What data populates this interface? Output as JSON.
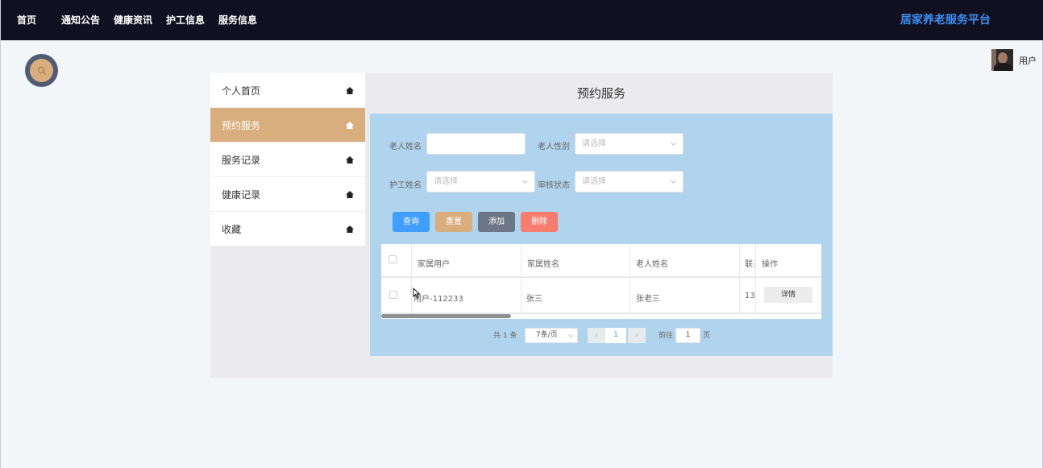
{
  "nav": {
    "items": [
      "首页",
      "通知公告",
      "健康资讯",
      "护工信息",
      "服务信息"
    ],
    "brand": "居家养老服务平台"
  },
  "user": {
    "name": "用户"
  },
  "sidebar": {
    "items": [
      {
        "label": "个人首页"
      },
      {
        "label": "预约服务"
      },
      {
        "label": "服务记录"
      },
      {
        "label": "健康记录"
      },
      {
        "label": "收藏"
      }
    ],
    "active": "预约服务"
  },
  "main": {
    "title": "预约服务"
  },
  "filters": {
    "elder_name_label": "老人姓名",
    "elder_name_value": "",
    "elder_gender_label": "老人性别",
    "elder_gender_placeholder": "请选择",
    "caregiver_label": "护工姓名",
    "caregiver_placeholder": "请选择",
    "review_label": "审核状态",
    "review_placeholder": "请选择"
  },
  "buttons": {
    "query": "查询",
    "reset": "重置",
    "add": "添加",
    "delete": "删除"
  },
  "colors": {
    "nav_bg": "#111020",
    "brand": "#3d8ef0",
    "accent": "#d9ae7e",
    "panel_bg": "#b0d4ee",
    "query_btn": "#409eff",
    "reset_btn": "#d9ae7e",
    "add_btn": "#6c7686",
    "delete_btn": "#f77d6f"
  },
  "table": {
    "headers": [
      "家属用户",
      "家属姓名",
      "老人姓名",
      "联系",
      "操作"
    ],
    "rows": [
      {
        "family_user": "用户-112233",
        "family_name": "张三",
        "elder_name": "张老三",
        "contact": "13",
        "action": "详情"
      }
    ]
  },
  "pagination": {
    "total": "共 1 条",
    "page_size": "7条/页",
    "current_page": "1",
    "goto_label": "前往",
    "goto_value": "1",
    "page_unit": "页"
  }
}
